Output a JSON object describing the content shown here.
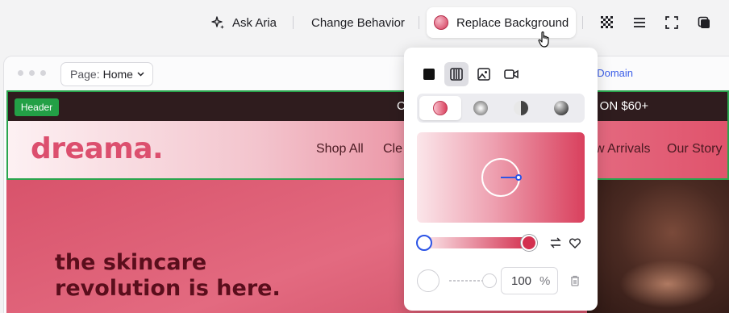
{
  "toolbar": {
    "ask_aria": "Ask Aria",
    "change_behavior": "Change Behavior",
    "replace_background": "Replace Background"
  },
  "frame": {
    "page_prefix": "Page:",
    "page_name": "Home",
    "domain_link": "t Domain"
  },
  "site": {
    "header_tag": "Header",
    "announcement_left": "C",
    "announcement_right": "s ON $60+",
    "logo": "dreama.",
    "nav": [
      "Shop All",
      "Cle",
      "w Arrivals",
      "Our Story"
    ],
    "hero_line1": "the skincare",
    "hero_line2": "revolution is here."
  },
  "background_panel": {
    "bg_types": [
      "color-icon",
      "gradient-icon",
      "image-icon",
      "video-icon"
    ],
    "active_bg_type": "gradient",
    "gradient_types": [
      "linear",
      "radial",
      "conic",
      "fluid"
    ],
    "active_gradient_type": "linear",
    "stop_colors": [
      "#fbe6ea",
      "#d3304f"
    ],
    "opacity_value": "100",
    "opacity_unit": "%"
  },
  "colors": {
    "header_outline": "#2aa54e",
    "accent_blue": "#2d55e6",
    "brand_pink": "#dc4f6e"
  }
}
